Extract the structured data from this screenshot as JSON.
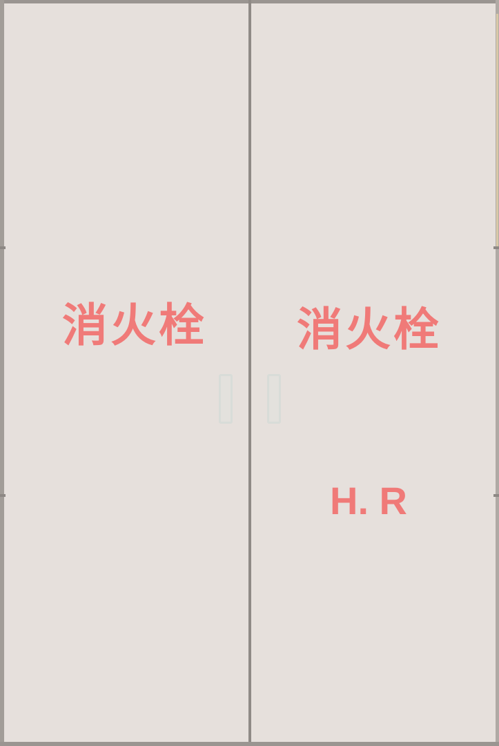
{
  "left_door": {
    "sign": "消火栓"
  },
  "right_door": {
    "sign": "消火栓",
    "code": "H. R"
  },
  "colors": {
    "panel": "#e6e0dc",
    "frame": "#9a9591",
    "sign_text": "#f07a78"
  }
}
